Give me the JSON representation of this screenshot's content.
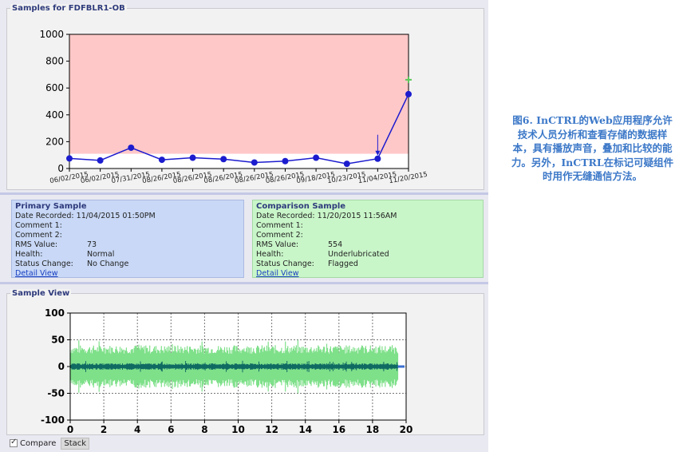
{
  "samples_panel": {
    "title": "Samples for FDFBLR1-OB"
  },
  "primary": {
    "title": "Primary Sample",
    "rows": [
      {
        "label": "Date Recorded:",
        "value": "11/04/2015 01:50PM"
      },
      {
        "label": "Comment 1:",
        "value": ""
      },
      {
        "label": "Comment 2:",
        "value": ""
      },
      {
        "label": "RMS Value:",
        "value": "73"
      },
      {
        "label": "Health:",
        "value": "Normal"
      },
      {
        "label": "Status Change:",
        "value": "No Change"
      }
    ],
    "link": "Detail View"
  },
  "comparison": {
    "title": "Comparison Sample",
    "rows": [
      {
        "label": "Date Recorded:",
        "value": "11/20/2015 11:56AM"
      },
      {
        "label": "Comment 1:",
        "value": ""
      },
      {
        "label": "Comment 2:",
        "value": ""
      },
      {
        "label": "RMS Value:",
        "value": "554"
      },
      {
        "label": "Health:",
        "value": "Underlubricated"
      },
      {
        "label": "Status Change:",
        "value": "Flagged"
      }
    ],
    "link": "Detail View"
  },
  "view_panel": {
    "title": "Sample View"
  },
  "controls": {
    "compare_label": "Compare",
    "stack_label": "Stack"
  },
  "caption": "图6. InCTRL的Web应用程序允许技术人员分析和查看存储的数据样本，具有播放声音，叠加和比较的能力。另外，InCTRL在标记可疑组件时用作无缝通信方法。",
  "colors": {
    "alarm_zone": "#ffc8c8",
    "series": "#1c1ccf",
    "comparison_wave": "#7fe08a",
    "primary_wave": "#0f6b62"
  },
  "chart_data": [
    {
      "type": "line",
      "x": [
        "06/02/2015",
        "06/02/2015",
        "07/31/2015",
        "08/26/2015",
        "08/26/2015",
        "08/26/2015",
        "08/26/2015",
        "08/26/2015",
        "09/18/2015",
        "10/23/2015",
        "11/04/2015",
        "11/20/2015"
      ],
      "values": [
        75,
        60,
        155,
        65,
        80,
        70,
        45,
        55,
        80,
        35,
        73,
        554
      ],
      "ylim": [
        0,
        1000
      ],
      "yticks": [
        "0",
        "200",
        "400",
        "600",
        "800",
        "1000"
      ],
      "alarm_band": [
        110,
        1000
      ],
      "grid": false
    },
    {
      "type": "area",
      "series": [
        {
          "role": "comparison",
          "amplitude": [
            -40,
            40
          ]
        },
        {
          "role": "primary",
          "amplitude": [
            -6,
            6
          ]
        }
      ],
      "xlim": [
        0,
        20
      ],
      "ylim": [
        -100,
        100
      ],
      "xticks": [
        "0",
        "2",
        "4",
        "6",
        "8",
        "10",
        "12",
        "14",
        "16",
        "18",
        "20"
      ],
      "yticks": [
        "100",
        "50",
        "0",
        "-50",
        "-100"
      ],
      "signal_end": 19.5,
      "grid": true
    }
  ]
}
